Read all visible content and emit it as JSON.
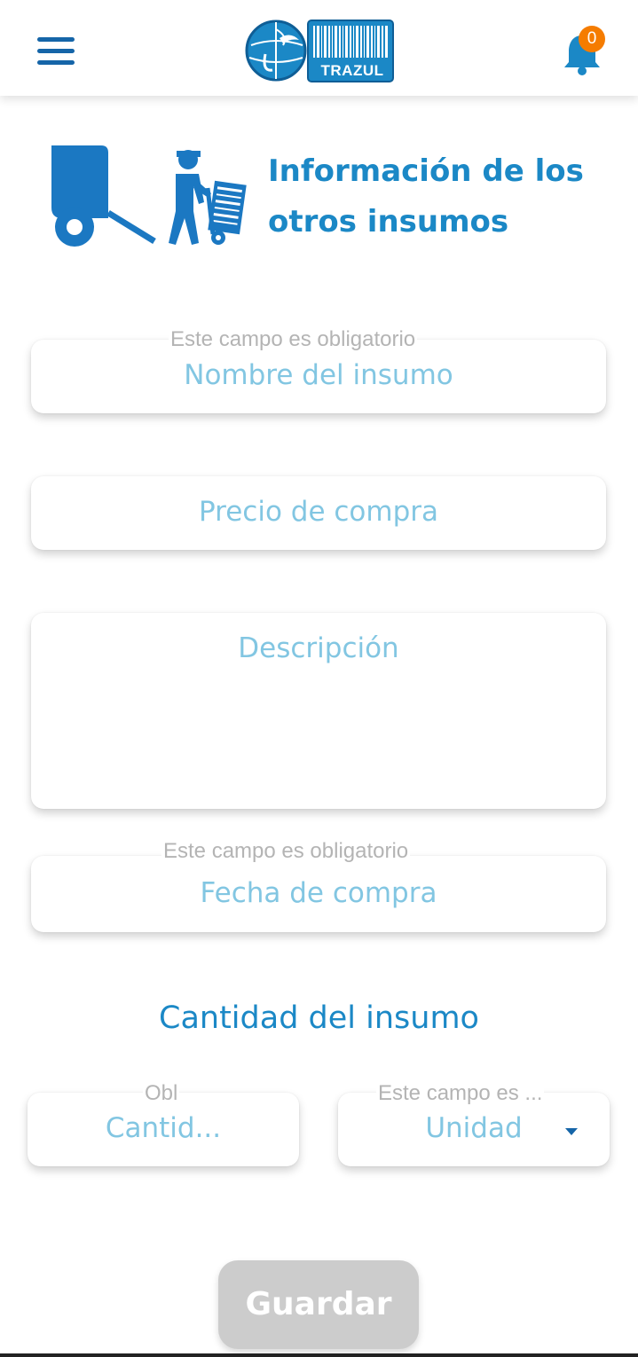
{
  "header": {
    "logo_text": "TRAZUL",
    "notification_count": "0",
    "colors": {
      "primary": "#1565a8",
      "accent": "#1b88c6",
      "badge": "#f57c00"
    }
  },
  "hero": {
    "title_line1": "Información de los",
    "title_line2": "otros insumos"
  },
  "form": {
    "name": {
      "hint": "Este campo es obligatorio",
      "placeholder": "Nombre del insumo"
    },
    "price": {
      "placeholder": "Precio de compra"
    },
    "description": {
      "placeholder": "Descripción"
    },
    "date": {
      "hint": "Este campo es obligatorio",
      "placeholder": "Fecha de compra"
    },
    "quantity_section_title": "Cantidad del insumo",
    "quantity": {
      "hint": "Obl",
      "placeholder": "Cantid..."
    },
    "unit": {
      "hint": "Este campo es ...",
      "placeholder": "Unidad"
    },
    "save_label": "Guardar"
  }
}
